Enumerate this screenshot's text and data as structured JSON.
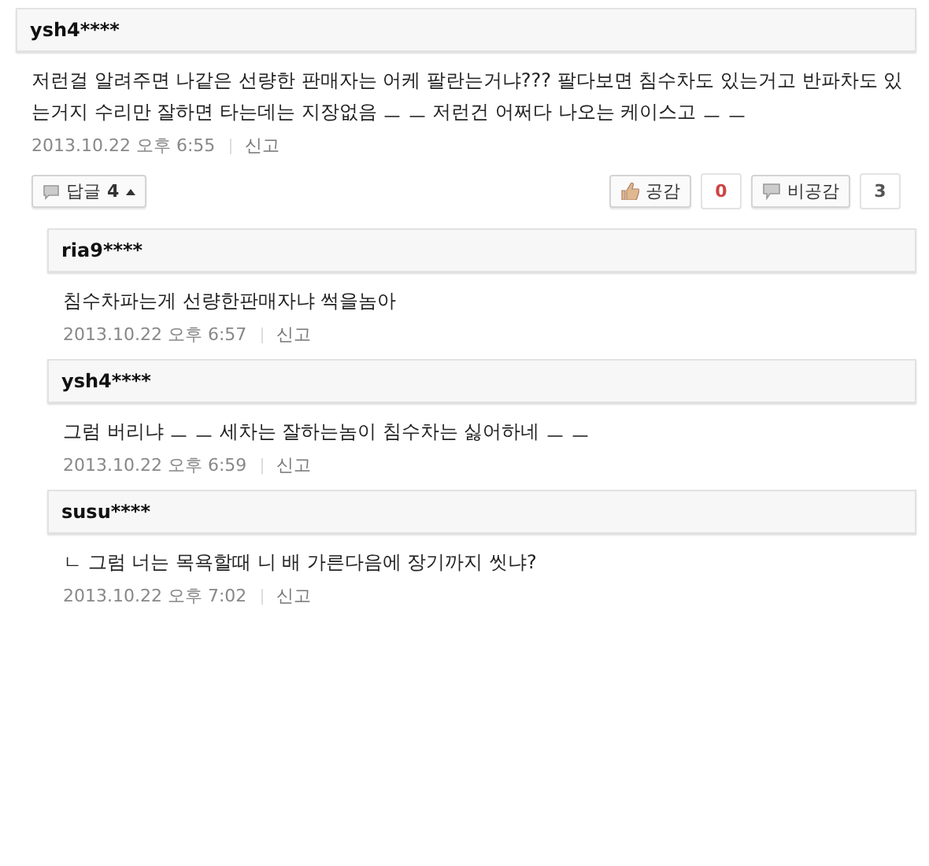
{
  "comment": {
    "author": "ysh4****",
    "text": "저런걸 알려주면 나같은 선량한 판매자는 어케 팔란는거냐??? 팔다보면 침수차도 있는거고 반파차도 있는거지 수리만 잘하면 타는데는 지장없음 ㅡ ㅡ 저런건 어쩌다 나오는 케이스고 ㅡ ㅡ",
    "date": "2013.10.22 오후 6:55",
    "report": "신고",
    "replies_button": {
      "label": "답글",
      "count": "4",
      "expanded": true
    },
    "like": {
      "label": "공감",
      "count": "0"
    },
    "dislike": {
      "label": "비공감",
      "count": "3"
    }
  },
  "replies": [
    {
      "author": "ria9****",
      "text": "침수차파는게 선량한판매자냐 썩을놈아",
      "date": "2013.10.22 오후 6:57",
      "report": "신고"
    },
    {
      "author": "ysh4****",
      "text": "그럼 버리냐 ㅡ ㅡ 세차는 잘하는놈이 침수차는 싫어하네 ㅡ ㅡ",
      "date": "2013.10.22 오후 6:59",
      "report": "신고"
    },
    {
      "author": "susu****",
      "text": "ㄴ 그럼 너는 목욕할때 니 배 가른다음에 장기까지 씻냐?",
      "date": "2013.10.22 오후 7:02",
      "report": "신고"
    }
  ]
}
